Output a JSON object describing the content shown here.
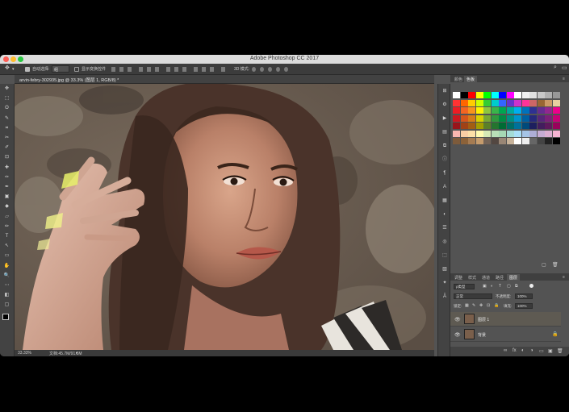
{
  "window": {
    "title": "Adobe Photoshop CC 2017"
  },
  "options_bar": {
    "auto_select_label": "自动选择:",
    "auto_select_value": "组",
    "show_transform_label": "显示变换控件"
  },
  "document": {
    "tab_label": "arvin-febry-302935.jpg @ 33.3% (图层 1, RGB/8) *"
  },
  "status": {
    "zoom": "33.33%",
    "doc_size": "文档:45.7M/91.5M"
  },
  "tools": [
    "✥",
    "⬚",
    "ʘ",
    "✎",
    "⌗",
    "✂",
    "✐",
    "⊡",
    "✚",
    "✑",
    "✒",
    "▣",
    "◆",
    "▱",
    "✏",
    "T",
    "↖",
    "▭",
    "✋",
    "🔍",
    "⋯",
    "◧",
    "▢"
  ],
  "strip_icons": [
    "⊞",
    "⚙",
    "▶",
    "▤",
    "⧉",
    "ⓘ",
    "¶",
    "A",
    "▦",
    "◐",
    "☰",
    "◎",
    "⬚",
    "▧",
    "✦",
    "Ā"
  ],
  "swatches_panel": {
    "tabs": [
      "颜色",
      "色板"
    ],
    "active_tab": 1
  },
  "layers_panel": {
    "tabs": [
      "调整",
      "样式",
      "通道",
      "路径",
      "图层"
    ],
    "active_tab": 4,
    "filter_kind": "ρ类型",
    "blend_mode": "正常",
    "opacity_label": "不透明度:",
    "opacity_value": "100%",
    "lock_label": "锁定:",
    "fill_label": "填充:",
    "fill_value": "100%",
    "layers": [
      {
        "name": "图层 1",
        "selected": true
      },
      {
        "name": "背景",
        "selected": false,
        "locked": true
      }
    ],
    "footer_icons": [
      "∞",
      "fx",
      "◐",
      "◑",
      "▭",
      "▣",
      "🗑"
    ]
  },
  "colors": {
    "app_bg": "#535353",
    "panel_dark": "#3c3c3c",
    "selected_layer": "#5e5a52"
  },
  "swatch_colors": [
    [
      "#ffffff",
      "#000000",
      "#ff0000",
      "#ffff00",
      "#00ff00",
      "#00ffff",
      "#0000ff",
      "#ff00ff",
      "#ffffff",
      "#f2f2f2",
      "#e0e0e0",
      "#c8c8c8",
      "#b0b0b0",
      "#989898"
    ],
    [
      "#ff3333",
      "#ff6600",
      "#ffcc00",
      "#ccff00",
      "#33cc33",
      "#00cccc",
      "#3366ff",
      "#6633cc",
      "#cc33cc",
      "#ff3399",
      "#cc6666",
      "#996633",
      "#cc9966",
      "#e8cfa0"
    ],
    [
      "#ed1c24",
      "#f26522",
      "#f7941d",
      "#fff200",
      "#8dc63f",
      "#39b54a",
      "#00a651",
      "#00a99d",
      "#00aeef",
      "#0072bc",
      "#2e3192",
      "#662d91",
      "#92278f",
      "#ec008c"
    ],
    [
      "#cc1820",
      "#d4561c",
      "#d67d18",
      "#d9d100",
      "#78a835",
      "#30993e",
      "#008c44",
      "#008f84",
      "#0094cc",
      "#0060a0",
      "#26297b",
      "#56267a",
      "#7c2179",
      "#c80077"
    ],
    [
      "#99141a",
      "#a04216",
      "#a25e12",
      "#a39e00",
      "#5b8028",
      "#25752f",
      "#006b34",
      "#006d65",
      "#00719b",
      "#004a7a",
      "#1d1f5e",
      "#421d5d",
      "#5e195c",
      "#99005b"
    ],
    [
      "#f9b7b0",
      "#fbcfa5",
      "#fde0a8",
      "#fffbb0",
      "#d6e9b5",
      "#b9dfb8",
      "#a6d8b4",
      "#a4dbd5",
      "#a9def7",
      "#a5c4e6",
      "#aeaed6",
      "#c6acd3",
      "#dcaed1",
      "#f6b4d2"
    ],
    [
      "#7d5b3b",
      "#8c6239",
      "#a67c52",
      "#c69c6d",
      "#736357",
      "#534741",
      "#998675",
      "#c7b299",
      "#ffffff",
      "#eeeeee",
      "#666666",
      "#444444",
      "#222222",
      "#000000"
    ]
  ]
}
